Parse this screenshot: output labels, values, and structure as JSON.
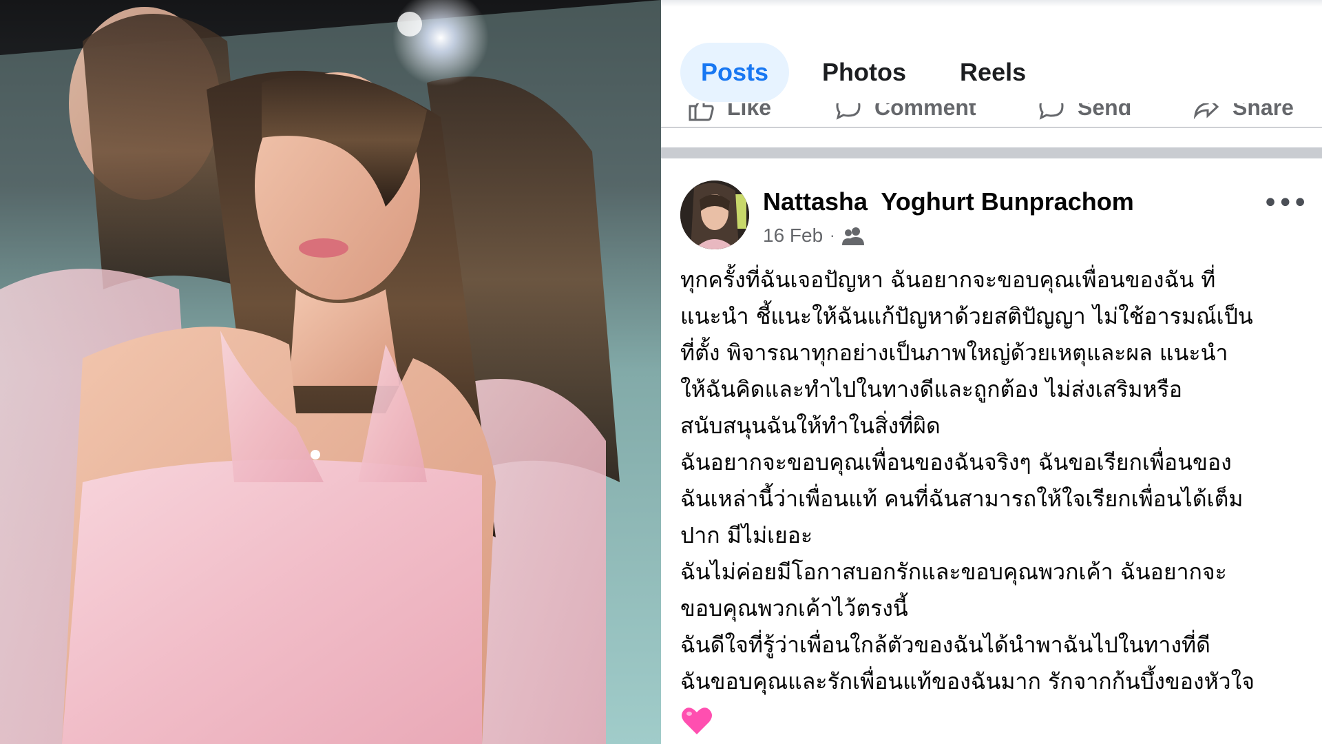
{
  "tabs": [
    {
      "label": "Posts",
      "active": true
    },
    {
      "label": "Photos",
      "active": false
    },
    {
      "label": "Reels",
      "active": false
    }
  ],
  "actions": [
    {
      "label": "Like",
      "icon": "like-icon"
    },
    {
      "label": "Comment",
      "icon": "comment-icon"
    },
    {
      "label": "Send",
      "icon": "send-icon"
    },
    {
      "label": "Share",
      "icon": "share-icon"
    }
  ],
  "post": {
    "author": "Nattasha  Yoghurt Bunprachom",
    "date": "16 Feb",
    "separator": "·",
    "audience_icon": "friends-icon",
    "more_label": "•••",
    "lines": [
      "ทุกครั้งที่ฉันเจอปัญหา ฉันอยากจะขอบคุณเพื่อนของฉัน  ที่",
      "แนะนำ ชี้แนะให้ฉันแก้ปัญหาด้วยสติปัญญา ไม่ใช้อารมณ์เป็น",
      "ที่ตั้ง พิจารณาทุกอย่างเป็นภาพใหญ่ด้วยเหตุและผล แนะนำ",
      "ให้ฉันคิดและทำไปในทางดีและถูกต้อง ไม่ส่งเสริมหรือ",
      "สนับสนุนฉันให้ทำในสิ่งที่ผิด",
      "ฉันอยากจะขอบคุณเพื่อนของฉันจริงๆ ฉันขอเรียกเพื่อนของ",
      "ฉันเหล่านี้ว่าเพื่อนแท้ คนที่ฉันสามารถให้ใจเรียกเพื่อนได้เต็ม",
      "ปาก มีไม่เยอะ",
      "ฉันไม่ค่อยมีโอกาสบอกรักและขอบคุณพวกเค้า ฉันอยากจะ",
      "ขอบคุณพวกเค้าไว้ตรงนี้",
      "ฉันดีใจที่รู้ว่าเพื่อนใกล้ตัวของฉันได้นำพาฉันไปในทางที่ดี",
      "ฉันขอบคุณและรักเพื่อนแท้ของฉันมาก รักจากก้นบึ้งของหัวใจ"
    ],
    "emoji": "pink-heart-icon"
  },
  "colors": {
    "accent": "#1877f2",
    "active_tab_bg": "#e7f3ff",
    "text": "#050505",
    "muted": "#65676b",
    "heart": "#ff4fb0"
  }
}
